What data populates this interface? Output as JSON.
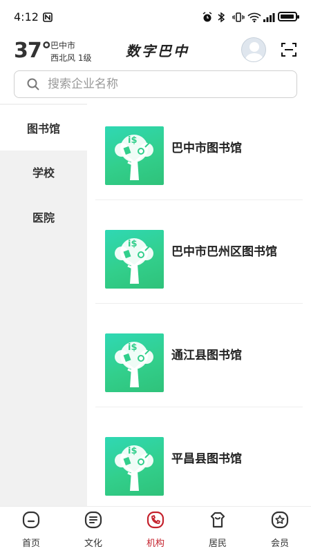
{
  "status_bar": {
    "time": "4:12"
  },
  "header": {
    "temperature": "37°",
    "city": "巴中市",
    "wind": "西北风  1级",
    "app_title": "数字巴中"
  },
  "search": {
    "placeholder": "搜索企业名称"
  },
  "sidebar": {
    "items": [
      {
        "label": "图书馆",
        "active": true
      },
      {
        "label": "学校",
        "active": false
      },
      {
        "label": "医院",
        "active": false
      }
    ]
  },
  "list": {
    "items": [
      {
        "name": "巴中市图书馆"
      },
      {
        "name": "巴中市巴州区图书馆"
      },
      {
        "name": "通江县图书馆"
      },
      {
        "name": "平昌县图书馆"
      }
    ]
  },
  "tabbar": {
    "items": [
      {
        "label": "首页",
        "icon": "home-icon"
      },
      {
        "label": "文化",
        "icon": "culture-icon"
      },
      {
        "label": "机构",
        "icon": "institution-icon",
        "active": true
      },
      {
        "label": "居民",
        "icon": "resident-icon"
      },
      {
        "label": "会员",
        "icon": "member-icon"
      }
    ],
    "active_color": "#c4202b"
  },
  "colors": {
    "thumb_green": "#32cf8c",
    "sidebar_bg": "#f1f1f1"
  }
}
